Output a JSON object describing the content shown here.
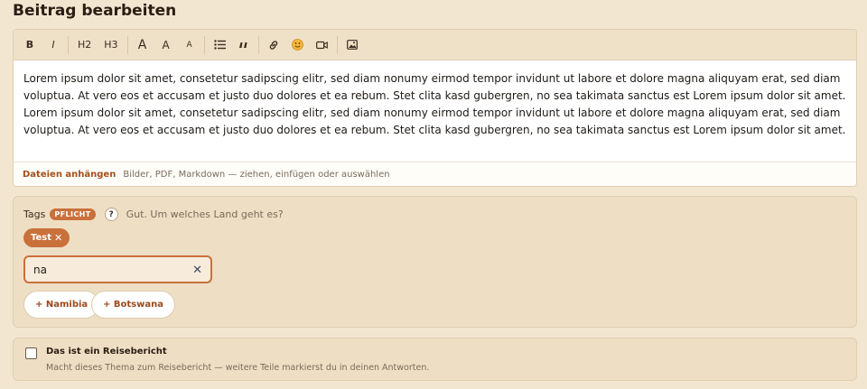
{
  "page": {
    "title": "Beitrag bearbeiten"
  },
  "toolbar": {
    "bold": "B",
    "italic": "I",
    "h2": "H2",
    "h3": "H3",
    "size_large": "A",
    "size_medium": "A",
    "size_small": "A",
    "icons": [
      "list-icon",
      "quote-icon",
      "link-icon",
      "emoji-icon",
      "video-icon",
      "image-icon"
    ]
  },
  "editor": {
    "body": "Lorem ipsum dolor sit amet, consetetur sadipscing elitr, sed diam nonumy eirmod tempor invidunt ut labore et dolore magna aliquyam erat, sed diam voluptua. At vero eos et accusam et justo duo dolores et ea rebum. Stet clita kasd gubergren, no sea takimata sanctus est Lorem ipsum dolor sit amet. Lorem ipsum dolor sit amet, consetetur sadipscing elitr, sed diam nonumy eirmod tempor invidunt ut labore et dolore magna aliquyam erat, sed diam voluptua. At vero eos et accusam et justo duo dolores et ea rebum. Stet clita kasd gubergren, no sea takimata sanctus est Lorem ipsum dolor sit amet."
  },
  "attachments": {
    "link": "Dateien anhängen",
    "hint": "Bilder, PDF, Markdown — ziehen, einfügen oder auswählen"
  },
  "tags": {
    "label": "Tags",
    "required_badge": "PFLICHT",
    "help": "?",
    "hint": "Gut. Um welches Land geht es?",
    "selected": [
      {
        "label": "Test",
        "remove": "✕"
      }
    ],
    "input_value": "na",
    "clear": "✕",
    "suggestions": [
      "+ Namibia",
      "+ Botswana"
    ]
  },
  "travel_report": {
    "checked": false,
    "title": "Das ist ein Reisebericht",
    "description": "Macht dieses Thema zum Reisebericht — weitere Teile markierst du in deinen Antworten."
  },
  "colors": {
    "background": "#f3e6d1",
    "panel": "#eedfc4",
    "accent": "#c9703b",
    "link": "#a34f1a"
  }
}
